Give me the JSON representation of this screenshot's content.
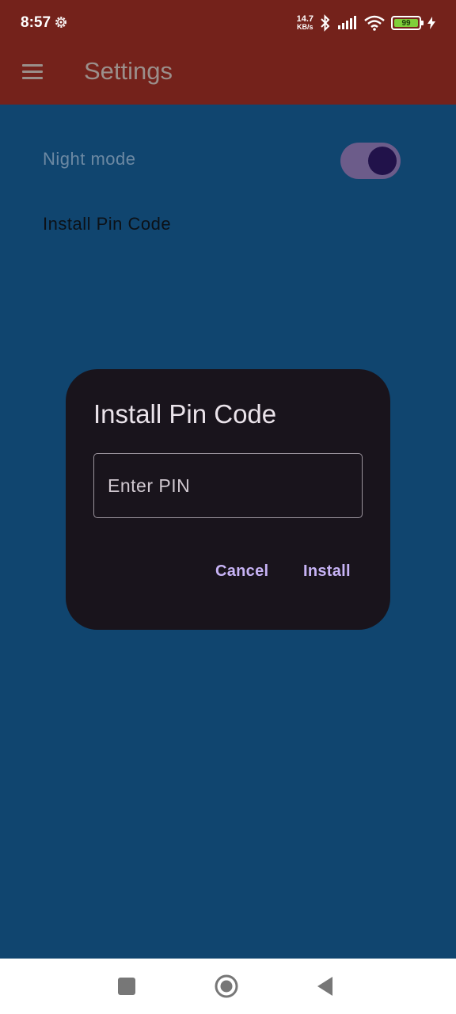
{
  "status_bar": {
    "time": "8:57",
    "net_speed_value": "14.7",
    "net_speed_unit": "KB/s",
    "battery_level": "99",
    "icons": [
      "settings-gear-icon",
      "bluetooth-icon",
      "signal-icon",
      "wifi-icon",
      "battery-icon",
      "charging-icon"
    ]
  },
  "app_bar": {
    "title": "Settings",
    "menu_icon": "menu-icon",
    "color": "#74221b"
  },
  "settings": {
    "night_mode_label": "Night mode",
    "night_mode_enabled": true,
    "install_pin_label": "Install Pin Code"
  },
  "dialog": {
    "title": "Install Pin Code",
    "pin_placeholder": "Enter PIN",
    "pin_value": "",
    "cancel_label": "Cancel",
    "install_label": "Install",
    "accent": "#c7b3f5"
  },
  "nav_bar": {
    "buttons": [
      "recents-icon",
      "home-icon",
      "back-icon"
    ]
  },
  "colors": {
    "background": "#10456f",
    "dialog_background": "#19141c"
  }
}
